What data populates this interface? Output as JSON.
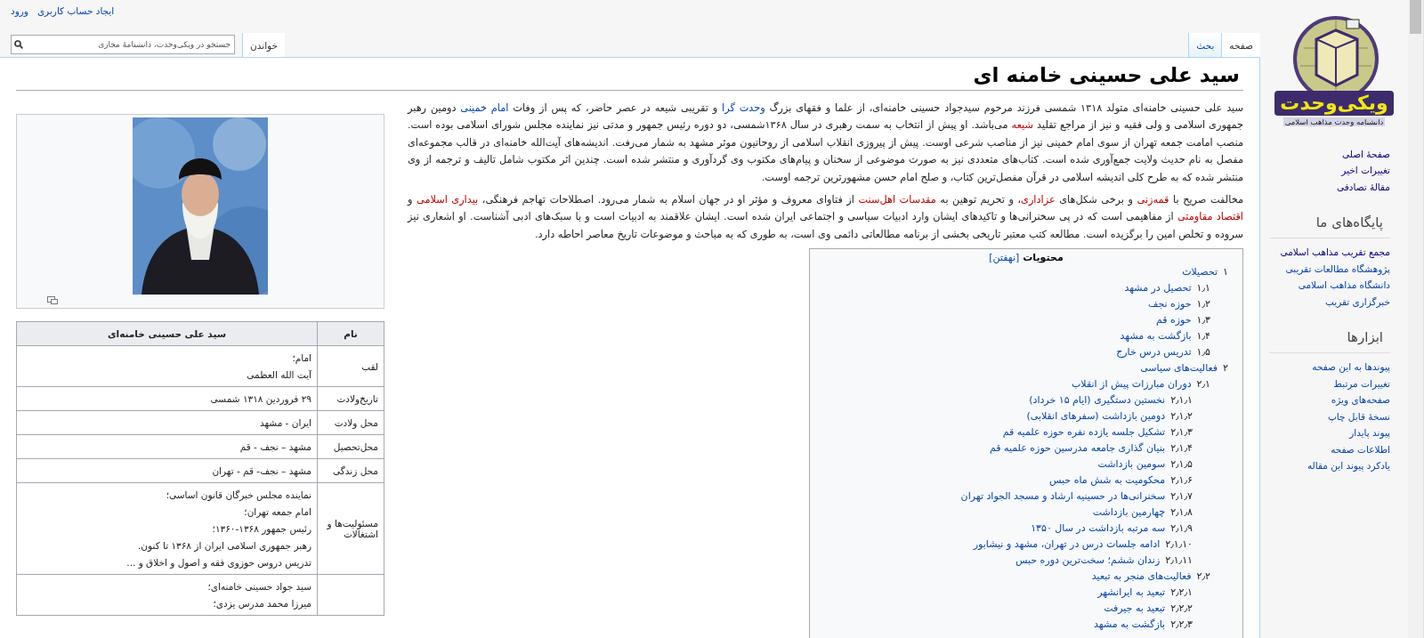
{
  "personal_links": [
    {
      "label": "ایجاد حساب کاربری"
    },
    {
      "label": "ورود"
    }
  ],
  "namespace_tabs": [
    {
      "label": "صفحه",
      "selected": true
    },
    {
      "label": "بحث",
      "selected": false
    }
  ],
  "view_tabs": [
    {
      "label": "خواندن",
      "selected": true
    }
  ],
  "search": {
    "placeholder": "جستجو در ویکی‌وحدت، دانشنامهٔ مجازی"
  },
  "logo": {
    "title": "ویکی‌وحدت",
    "subtitle": "دانشنامه وحدت مذاهب اسلامی"
  },
  "sidebar": {
    "sections": [
      {
        "links": [
          {
            "label": "صفحهٔ اصلی",
            "visited": true
          },
          {
            "label": "تغییرات اخیر",
            "visited": true
          },
          {
            "label": "مقالهٔ تصادفی",
            "visited": true
          }
        ]
      },
      {
        "heading": "پایگاه‌های ما",
        "links": [
          {
            "label": "مجمع تقریب مذاهب اسلامی",
            "visited": true
          },
          {
            "label": "پژوهشگاه مطالعات تقریبی",
            "visited": false
          },
          {
            "label": "دانشگاه مذاهب اسلامی",
            "visited": false
          },
          {
            "label": "خبرگزاری تقریب",
            "visited": false
          }
        ]
      },
      {
        "heading": "ابزارها",
        "links": [
          {
            "label": "پیوندها به این صفحه",
            "visited": false
          },
          {
            "label": "تغییرات مرتبط",
            "visited": false
          },
          {
            "label": "صفحه‌های ویژه",
            "visited": false
          },
          {
            "label": "نسخهٔ قابل چاپ",
            "visited": false
          },
          {
            "label": "پیوند پایدار",
            "visited": false
          },
          {
            "label": "اطلاعات صفحه",
            "visited": false
          },
          {
            "label": "یادکرد پیوند این مقاله",
            "visited": false
          }
        ]
      }
    ]
  },
  "article": {
    "title": "سید علی حسینی خامنه ای",
    "paragraphs": [
      [
        {
          "kind": "plain",
          "text": "سید علی حسینی خامنه‌ای متولد ۱۳۱۸ شمسی فرزند مرحوم سیدجواد حسینی خامنه‌ای، از علما و فقهای بزرگ "
        },
        {
          "kind": "link",
          "text": "وحدت گرا"
        },
        {
          "kind": "plain",
          "text": " و تقریبی شیعه در عصر حاضر، که پس از وفات "
        },
        {
          "kind": "link",
          "text": "امام خمینی"
        },
        {
          "kind": "plain",
          "text": " دومین رهبر جمهوری اسلامی و ولی فقیه و نیز از مراجع تقلید "
        },
        {
          "kind": "redlink",
          "text": "شیعه"
        },
        {
          "kind": "plain",
          "text": " می‌باشد. او پیش از انتخاب به سمت رهبری در سال ۱۳۶۸شمسی، دو دوره رئیس جمهور و مدتی نیز نماینده مجلس شورای اسلامی بوده است. منصب امامت جمعه تهران از سوی امام خمینی نیز از مناصب شرعی اوست. پیش از پیروزی انقلاب اسلامی از روحانیون موثر مشهد به شمار می‌رفت. اندیشه‌های آیت‌الله خامنه‌ای در قالب مجموعه‌ای مفصل به نام حدیث ولایت جمع‌آوری شده است. کتاب‌های متعددی نیز به صورت موضوعی از سخنان و پیام‌های مکتوب وی گردآوری و منتشر شده است. چندین اثر مکتوب شامل تالیف و ترجمه از وی منتشر شده که به طرح کلی اندیشه اسلامی در قرآن مفصل‌ترین کتاب، و صلح امام حسن مشهورترین ترجمه اوست."
        }
      ],
      [
        {
          "kind": "plain",
          "text": "مخالفت صریح با "
        },
        {
          "kind": "redlink",
          "text": "قمه‌زنی"
        },
        {
          "kind": "plain",
          "text": " و برخی شکل‌های "
        },
        {
          "kind": "redlink",
          "text": "عزاداری"
        },
        {
          "kind": "plain",
          "text": "، و تحریم توهین به "
        },
        {
          "kind": "redlink",
          "text": "مقدسات اهل‌سنت"
        },
        {
          "kind": "plain",
          "text": " از فتاوای معروف و مؤثر او در جهان اسلام به شمار می‌رود. اصطلاحات تهاجم فرهنگی، "
        },
        {
          "kind": "redlink",
          "text": "بیداری اسلامی"
        },
        {
          "kind": "plain",
          "text": " و "
        },
        {
          "kind": "redlink",
          "text": "اقتصاد مقاومتی"
        },
        {
          "kind": "plain",
          "text": " از مفاهیمی است که در پی سخنرانی‌ها و تاکیدهای ایشان وارد ادبیات سیاسی و اجتماعی ایران شده است. ایشان علاقمند به ادبیات است و با سبک‌های ادبی آشناست. او اشعاری نیز سروده و تخلص امین را برگزیده است. مطالعه کتب معتبر تاریخی بخشی از برنامه مطالعاتی دائمی وی است، به طوری که به مباحث و موضوعات تاریخ معاصر احاطه دارد."
        }
      ]
    ],
    "toc": {
      "title": "محتویات",
      "toggle": "[نهفتن]",
      "items": [
        {
          "number": "۱",
          "text": "تحصیلات",
          "children": [
            {
              "number": "۱٫۱",
              "text": "تحصیل در مشهد"
            },
            {
              "number": "۱٫۲",
              "text": "حوزه نجف"
            },
            {
              "number": "۱٫۳",
              "text": "حوزه قم"
            },
            {
              "number": "۱٫۴",
              "text": "بازگشت به مشهد"
            },
            {
              "number": "۱٫۵",
              "text": "تدریس درس خارج"
            }
          ]
        },
        {
          "number": "۲",
          "text": "فعالیت‌های سیاسی",
          "children": [
            {
              "number": "۲٫۱",
              "text": "دوران مبارزات پیش از انقلاب",
              "children": [
                {
                  "number": "۲٫۱٫۱",
                  "text": "نخستین دستگیری (ایام ۱۵ خرداد)"
                },
                {
                  "number": "۲٫۱٫۲",
                  "text": "دومین بازداشت (سفرهای انقلابی)"
                },
                {
                  "number": "۲٫۱٫۳",
                  "text": "تشکیل جلسه یازده نفره حوزه علمیه قم"
                },
                {
                  "number": "۲٫۱٫۴",
                  "text": "بنیان گذاری جامعه مدرسین حوزه علمیه قم"
                },
                {
                  "number": "۲٫۱٫۵",
                  "text": "سومین بازداشت"
                },
                {
                  "number": "۲٫۱٫۶",
                  "text": "محکومیت به شش ماه حبس"
                },
                {
                  "number": "۲٫۱٫۷",
                  "text": "سخنرانی‌ها در حسینیه ارشاد و مسجد الجواد تهران"
                },
                {
                  "number": "۲٫۱٫۸",
                  "text": "چهارمین بازداشت"
                },
                {
                  "number": "۲٫۱٫۹",
                  "text": "سه مرتبه بازداشت در سال ۱۳۵۰"
                },
                {
                  "number": "۲٫۱٫۱۰",
                  "text": "ادامه جلسات درس در تهران، مشهد و نیشابور"
                },
                {
                  "number": "۲٫۱٫۱۱",
                  "text": "زندان ششم؛ سخت‌ترین دوره حبس"
                }
              ]
            },
            {
              "number": "۲٫۲",
              "text": "فعالیت‌های منجر به تبعید",
              "children": [
                {
                  "number": "۲٫۲٫۱",
                  "text": "تبعید به ایرانشهر"
                },
                {
                  "number": "۲٫۲٫۲",
                  "text": "تبعید به جیرفت"
                },
                {
                  "number": "۲٫۲٫۳",
                  "text": "بازگشت به مشهد"
                }
              ]
            }
          ]
        }
      ]
    }
  },
  "infobox": {
    "header": {
      "label": "نام",
      "value": "سید علی حسینی خامنه‌ای"
    },
    "rows": [
      {
        "label": "لقب",
        "values": [
          "امام؛",
          "آیت الله العظمی"
        ]
      },
      {
        "label": "تاریخ‌ولادت",
        "values": [
          "۲۹ فروردین ۱۳۱۸ شمسی"
        ]
      },
      {
        "label": "محل ولادت",
        "values": [
          "ایران - مشهد"
        ]
      },
      {
        "label": "محل‌تحصیل",
        "values": [
          "مشهد – نجف - قم"
        ]
      },
      {
        "label": "محل زندگی",
        "values": [
          "مشهد – نجف- قم - تهران"
        ]
      },
      {
        "label": "مسئولیت‌ها و اشتغالات",
        "values": [
          "نماینده مجلس خبرگان قانون اساسی؛",
          "امام جمعه تهران؛",
          "رئیس جمهور ۱۳۶۸-۱۳۶۰؛",
          "رهبر جمهوری اسلامی ایران از ۱۳۶۸ تا کنون.",
          "تدریس دروس حوزوی فقه و اصول و اخلاق و ..."
        ]
      },
      {
        "values": [
          "سید جواد حسینی خامنه‌ای؛",
          "میرزا محمد مدرس یزدی؛"
        ]
      }
    ]
  }
}
